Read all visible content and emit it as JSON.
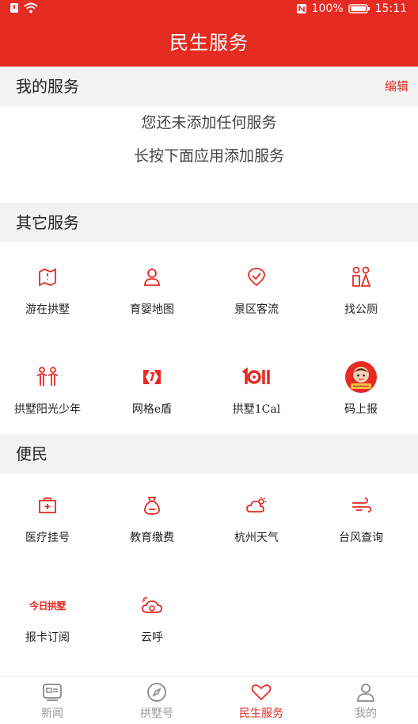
{
  "status": {
    "battery": "100%",
    "time": "15:11"
  },
  "header": {
    "title": "民生服务"
  },
  "my_services": {
    "title": "我的服务",
    "edit": "编辑",
    "empty_line1": "您还未添加任何服务",
    "empty_line2": "长按下面应用添加服务"
  },
  "other_services": {
    "title": "其它服务",
    "items": [
      {
        "label": "游在拱墅",
        "icon": "map-icon"
      },
      {
        "label": "育婴地图",
        "icon": "baby-person-icon"
      },
      {
        "label": "景区客流",
        "icon": "check-badge-icon"
      },
      {
        "label": "找公厕",
        "icon": "restroom-icon"
      },
      {
        "label": "拱墅阳光少年",
        "icon": "children-icon"
      },
      {
        "label": "网格e盾",
        "icon": "grid-shield-icon"
      },
      {
        "label": "拱墅1Cal",
        "icon": "1call-logo-icon"
      },
      {
        "label": "码上报",
        "icon": "mascot-avatar-icon"
      }
    ]
  },
  "convenience": {
    "title": "便民",
    "items": [
      {
        "label": "医疗挂号",
        "icon": "medical-kit-icon"
      },
      {
        "label": "教育缴费",
        "icon": "money-bag-icon"
      },
      {
        "label": "杭州天气",
        "icon": "weather-icon"
      },
      {
        "label": "台风查询",
        "icon": "wind-icon"
      },
      {
        "label": "报卡订阅",
        "icon": "newspaper-logo-icon",
        "logo_text": "今日拱墅"
      },
      {
        "label": "云呼",
        "icon": "cloud-call-icon"
      }
    ]
  },
  "tabs": [
    {
      "label": "新闻",
      "icon": "news-icon"
    },
    {
      "label": "拱墅号",
      "icon": "compass-icon"
    },
    {
      "label": "民生服务",
      "icon": "heart-icon",
      "active": true
    },
    {
      "label": "我的",
      "icon": "user-icon"
    }
  ],
  "colors": {
    "accent": "#e62b23",
    "section_bg": "#f2f2f2",
    "inactive": "#999999"
  }
}
